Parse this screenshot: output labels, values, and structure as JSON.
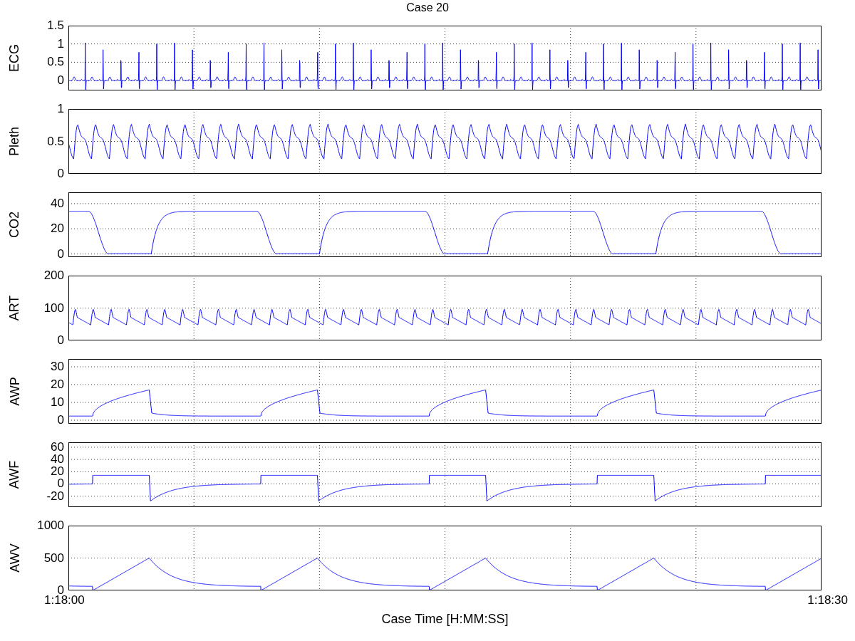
{
  "title": "Case 20",
  "panels": [
    {
      "kind": "ecg",
      "ylabel": "ECG",
      "ytick_labels": [
        "1.5",
        "1",
        "0.5",
        "0"
      ]
    },
    {
      "kind": "pleth",
      "ylabel": "Pleth",
      "ytick_labels": [
        "1",
        "0.5",
        "0"
      ]
    },
    {
      "kind": "co2",
      "ylabel": "CO2",
      "ytick_labels": [
        "40",
        "20",
        "0"
      ]
    },
    {
      "kind": "art",
      "ylabel": "ART",
      "ytick_labels": [
        "200",
        "100",
        "0"
      ]
    },
    {
      "kind": "awp",
      "ylabel": "AWP",
      "ytick_labels": [
        "30",
        "20",
        "10",
        "0"
      ]
    },
    {
      "kind": "awf",
      "ylabel": "AWF",
      "ytick_labels": [
        "60",
        "40",
        "20",
        "0",
        "-20"
      ]
    },
    {
      "kind": "awv",
      "ylabel": "AWV",
      "ytick_labels": [
        "1000",
        "500",
        "0"
      ]
    }
  ],
  "x_axis": {
    "tick_labels": [
      "1:18:00",
      "1:18:30"
    ],
    "label": "Case Time [H:MM:SS]"
  }
}
